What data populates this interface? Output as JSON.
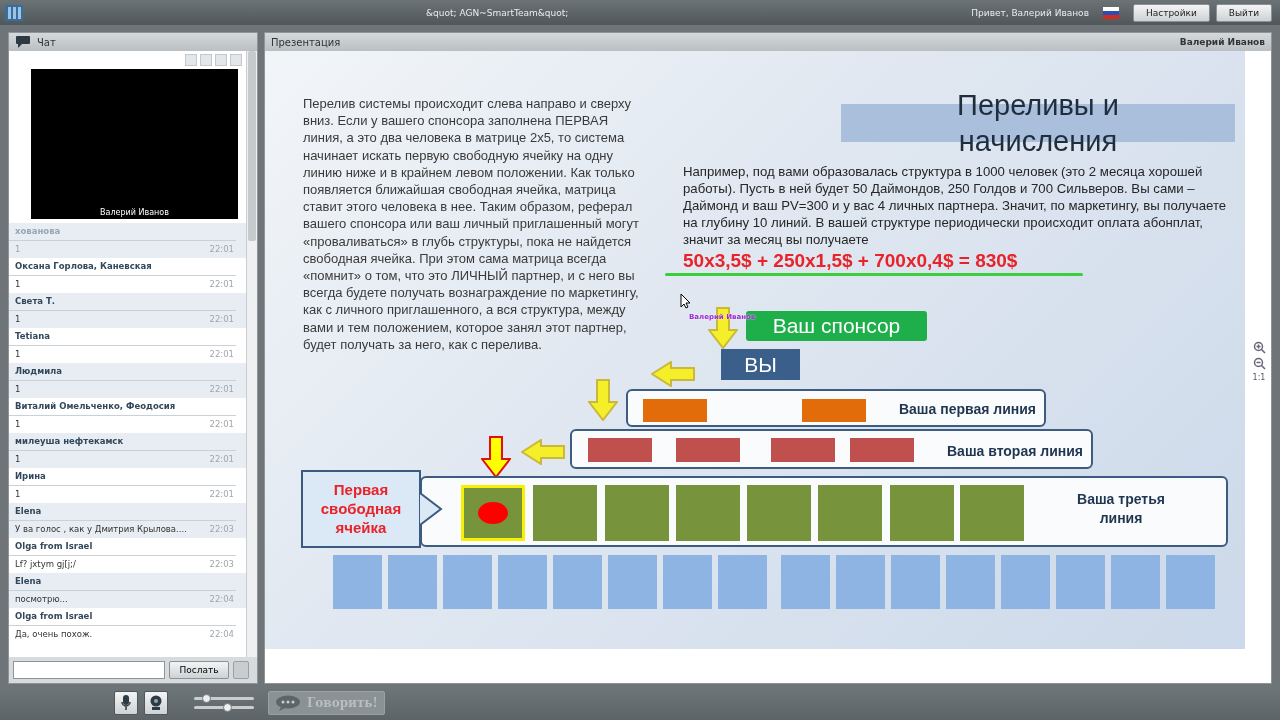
{
  "window": {
    "title": "&quot; AGN~SmartTeam&quot;",
    "greeting": "Привет, Валерий Иванов",
    "buttons": [
      "Настройки",
      "Выйти"
    ]
  },
  "chat": {
    "title": "Чат",
    "video_label": "Валерий Иванов",
    "messages": [
      {
        "author": "хованова",
        "text": "1",
        "time": "22:01",
        "dimmed": true
      },
      {
        "author": "Оксана Горлова, Каневская",
        "text": "1",
        "time": "22:01",
        "dimmed": false
      },
      {
        "author": "Света Т.",
        "text": "1",
        "time": "22:01",
        "dimmed": false
      },
      {
        "author": "Tetiana",
        "text": "1",
        "time": "22:01",
        "dimmed": false
      },
      {
        "author": "Людмила",
        "text": "1",
        "time": "22:01",
        "dimmed": false
      },
      {
        "author": "Виталий Омельченко, Феодосия",
        "text": "1",
        "time": "22:01",
        "dimmed": false
      },
      {
        "author": "милеуша нефтекамск",
        "text": "1",
        "time": "22:01",
        "dimmed": false
      },
      {
        "author": "Ирина",
        "text": "1",
        "time": "22:01",
        "dimmed": false
      },
      {
        "author": "Elena",
        "text": "У ва голос , как у Дмитрия Крылова....",
        "time": "22:03",
        "dimmed": false
      },
      {
        "author": "Olga from Israel",
        "text": "Lf? jxtym gj[j;/",
        "time": "22:03",
        "dimmed": false
      },
      {
        "author": "Elena",
        "text": "посмотрю...",
        "time": "22:04",
        "dimmed": false
      },
      {
        "author": "Olga from Israel",
        "text": "Да, очень похож.",
        "time": "22:04",
        "dimmed": false
      }
    ],
    "send_button": "Послать"
  },
  "presentation": {
    "title": "Презентация",
    "presenter": "Валерий Иванов",
    "zoom_reset": "1:1",
    "slide": {
      "paragraph": "Перелив системы происходит слева направо и сверху вниз.  Если у вашего спонсора заполнена ПЕРВАЯ линия, а это два человека в матрице 2x5, то система начинает искать первую свободную ячейку на одну линию ниже и в крайнем левом положении. Как только появляется ближайшая свободная ячейка, матрица ставит этого человека в нее. Таким образом, реферал вашего спонсора или ваш личный приглашенный могут «проваливаться» в глубь структуры, пока не найдется свободная ячейка. При этом сама матрица всегда «помнит» о том, что это ЛИЧНЫЙ партнер, и с него вы всегда будете получать вознаграждение по маркетингу, как с личного приглашенного, а вся структура, между вами и тем положением, которое занял этот партнер, будет получать за него, как с перелива.",
      "title": "Переливы и начисления",
      "example": "Например, под вами образовалась структура в 1000 человек (это 2 месяца хорошей работы). Пусть в ней будет 50 Даймондов, 250 Голдов и 700 Сильверов. Вы сами – Даймонд и ваш PV=300 и у вас 4 личных партнера. Значит, по маркетингу, вы получаете на глубину 10 линий. В вашей структуре периодически происходит оплата абонплат, значит за месяц вы получаете",
      "formula": "50x3,5$ + 250x1,5$ + 700x0,4$ = 830$",
      "cursor_label": "Валерий Иванов",
      "sponsor": "Ваш спонсор",
      "you": "ВЫ",
      "callout": "Первая свободная ячейка",
      "lines": [
        {
          "label": "Ваша первая линия",
          "color": "#e36c0a",
          "cells": [
            {
              "marked": false
            },
            {
              "marked": false
            }
          ]
        },
        {
          "label": "Ваша вторая линия",
          "color": "#c0504d",
          "cells": [
            {
              "marked": false
            },
            {
              "marked": false
            },
            {
              "marked": false
            },
            {
              "marked": false
            }
          ]
        },
        {
          "label": "Ваша третья линия",
          "color": "#77933c",
          "cells": [
            {
              "marked": true
            },
            {
              "marked": false
            },
            {
              "marked": false
            },
            {
              "marked": false
            },
            {
              "marked": false
            },
            {
              "marked": false
            },
            {
              "marked": false
            },
            {
              "marked": false
            }
          ]
        }
      ],
      "next_row": [
        {
          "marked": false
        },
        {
          "marked": false
        },
        {
          "marked": false
        },
        {
          "marked": false
        },
        {
          "marked": false
        },
        {
          "marked": false
        },
        {
          "marked": false
        },
        {
          "marked": false
        },
        {
          "marked": false
        },
        {
          "marked": false
        },
        {
          "marked": false
        },
        {
          "marked": false
        },
        {
          "marked": false
        },
        {
          "marked": false
        },
        {
          "marked": false
        },
        {
          "marked": false
        }
      ]
    }
  },
  "bottom_bar": {
    "talk_button": "Говорить!",
    "sliders": [
      {
        "level": 0.2
      },
      {
        "level": 0.55
      }
    ]
  }
}
